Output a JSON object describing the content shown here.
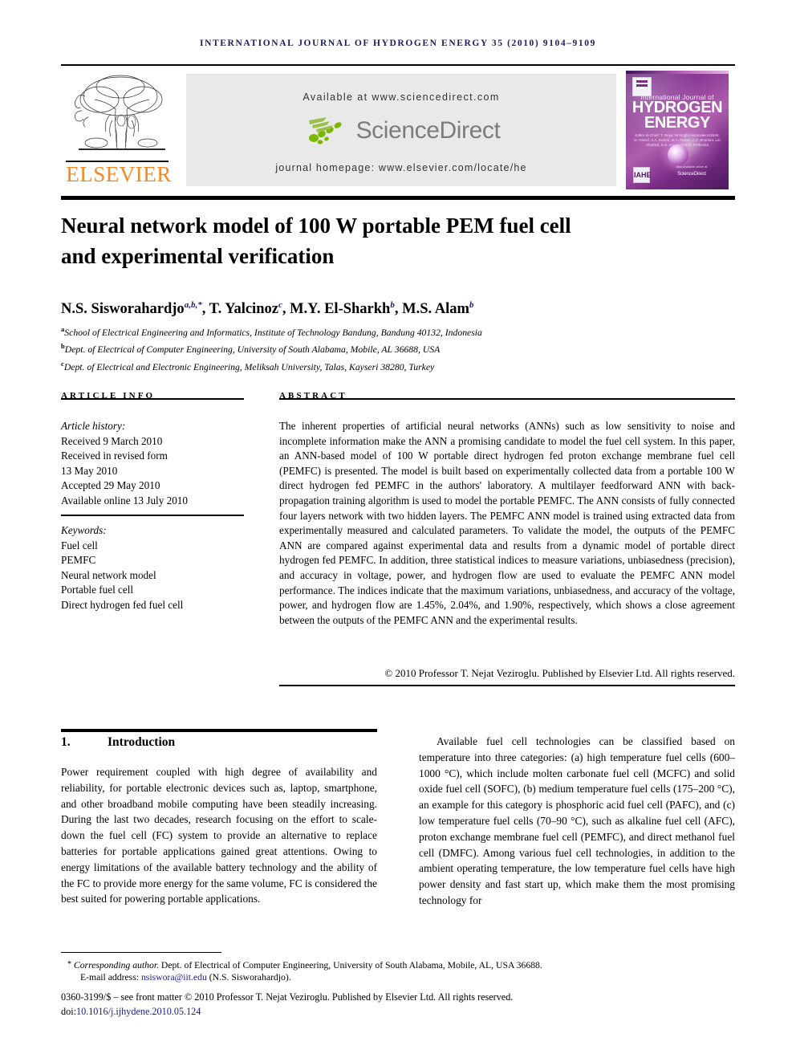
{
  "running_head": "International Journal of Hydrogen Energy 35 (2010) 9104–9109",
  "masthead": {
    "publisher_wordmark": "ELSEVIER",
    "available_at": "Available at www.sciencedirect.com",
    "sciencedirect_logo_text": "ScienceDirect",
    "journal_homepage": "journal homepage: www.elsevier.com/locate/he",
    "cover": {
      "line_top": "International Journal of",
      "title_line1": "HYDROGEN",
      "title_line2": "ENERGY",
      "editors": "Editor-in-Chief:  T. Nejat Veziroglu    Associate Editors:  D. Hissel, A.A. Karimi, M.A. Rosen, A.T. Shamim, Lei Shuford, C.S. Zavil and B.A. Prokocka",
      "badge_text": "IAHE",
      "sd_caption_top": "Also available online at",
      "sd_caption": "ScienceDirect"
    }
  },
  "article": {
    "title_line1": "Neural network model of 100 W portable PEM fuel cell",
    "title_line2": "and experimental verification",
    "authors": [
      {
        "name": "N.S. Sisworahardjo",
        "sup": "a,b,*"
      },
      {
        "name": "T. Yalcinoz",
        "sup": "c"
      },
      {
        "name": "M.Y. El-Sharkh",
        "sup": "b"
      },
      {
        "name": "M.S. Alam",
        "sup": "b"
      }
    ],
    "affiliations": [
      {
        "marker": "a",
        "text": "School of Electrical Engineering and Informatics, Institute of Technology Bandung, Bandung 40132, Indonesia"
      },
      {
        "marker": "b",
        "text": "Dept. of Electrical of Computer Engineering, University of South Alabama, Mobile, AL 36688, USA"
      },
      {
        "marker": "c",
        "text": "Dept. of Electrical and Electronic Engineering, Meliksah University, Talas, Kayseri 38280, Turkey"
      }
    ]
  },
  "info": {
    "header": "ARTICLE INFO",
    "history_label": "Article history:",
    "history": [
      "Received 9 March 2010",
      "Received in revised form",
      "13 May 2010",
      "Accepted 29 May 2010",
      "Available online 13 July 2010"
    ],
    "keywords_label": "Keywords:",
    "keywords": [
      "Fuel cell",
      "PEMFC",
      "Neural network model",
      "Portable fuel cell",
      "Direct hydrogen fed fuel cell"
    ]
  },
  "abstract": {
    "header": "ABSTRACT",
    "text": "The inherent properties of artificial neural networks (ANNs) such as low sensitivity to noise and incomplete information make the ANN a promising candidate to model the fuel cell system. In this paper, an ANN-based model of 100 W portable direct hydrogen fed proton exchange membrane fuel cell (PEMFC) is presented. The model is built based on experimentally collected data from a portable 100 W direct hydrogen fed PEMFC in the authors' laboratory. A multilayer feedforward ANN with back-propagation training algorithm is used to model the portable PEMFC. The ANN consists of fully connected four layers network with two hidden layers. The PEMFC ANN model is trained using extracted data from experimentally measured and calculated parameters. To validate the model, the outputs of the PEMFC ANN are compared against experimental data and results from a dynamic model of portable direct hydrogen fed PEMFC. In addition, three statistical indices to measure variations, unbiasedness (precision), and accuracy in voltage, power, and hydrogen flow are used to evaluate the PEMFC ANN model performance. The indices indicate that the maximum variations, unbiasedness, and accuracy of the voltage, power, and hydrogen flow are 1.45%, 2.04%, and 1.90%, respectively, which shows a close agreement between the outputs of the PEMFC ANN and the experimental results.",
    "copyright": "© 2010 Professor T. Nejat Veziroglu. Published by Elsevier Ltd. All rights reserved."
  },
  "body": {
    "section_number": "1.",
    "section_title": "Introduction",
    "left_paragraph": "Power requirement coupled with high degree of availability and reliability, for portable electronic devices such as, laptop, smartphone, and other broadband mobile computing have been steadily increasing. During the last two decades, research focusing on the effort to scale-down the fuel cell (FC) system to provide an alternative to replace batteries for portable applications gained great attentions. Owing to energy limitations of the available battery technology and the ability of the FC to provide more energy for the same volume, FC is considered the best suited for powering portable applications.",
    "right_paragraph": "Available fuel cell technologies can be classified based on temperature into three categories: (a) high temperature fuel cells (600–1000 °C), which include molten carbonate fuel cell (MCFC) and solid oxide fuel cell (SOFC), (b) medium temperature fuel cells (175–200 °C), an example for this category is phosphoric acid fuel cell (PAFC), and (c) low temperature fuel cells (70–90 °C), such as alkaline fuel cell (AFC), proton exchange membrane fuel cell (PEMFC), and direct methanol fuel cell (DMFC). Among various fuel cell technologies, in addition to the ambient operating temperature, the low temperature fuel cells have high power density and fast start up, which make them the most promising technology for"
  },
  "footer": {
    "corresponding_lead": "Corresponding author.",
    "corresponding_rest": " Dept. of Electrical of Computer Engineering, University of South Alabama, Mobile, AL, USA 36688.",
    "email_label": "E-mail address:",
    "email": "nsiswora@iit.edu",
    "email_owner": "(N.S. Sisworahardjo).",
    "issn_line": "0360-3199/$ – see front matter © 2010 Professor T. Nejat Veziroglu. Published by Elsevier Ltd. All rights reserved.",
    "doi_label": "doi:",
    "doi": "10.1016/j.ijhydene.2010.05.124"
  },
  "colors": {
    "elsevier_orange": "#f08a22",
    "runhead_navy": "#1b1b5e",
    "link_navy": "#1b1b8e",
    "banner_gray": "#e9e9e9",
    "sciencedirect_green": "#7ab800",
    "sciencedirect_gray": "#7c7c7c"
  }
}
